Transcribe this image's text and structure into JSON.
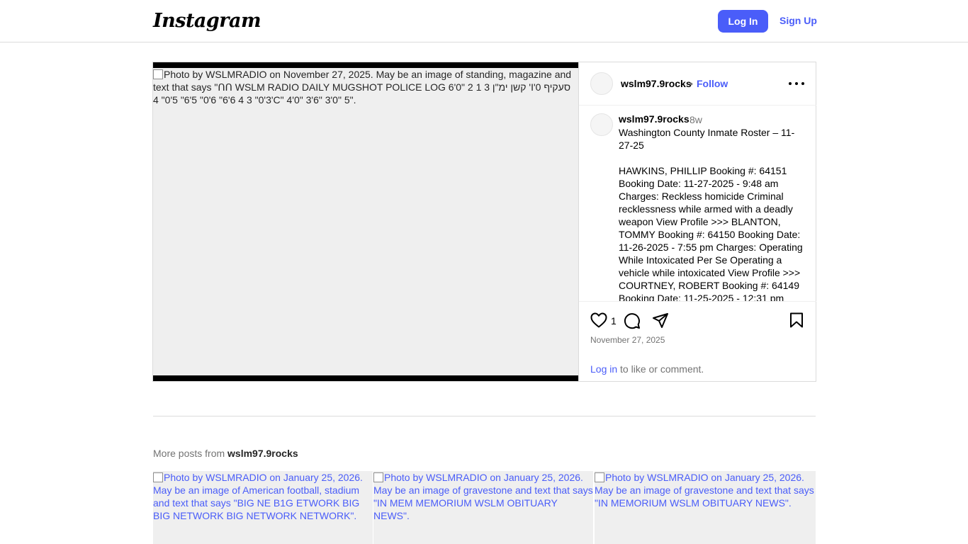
{
  "header": {
    "logo": "Instagram",
    "login_label": "Log In",
    "signup_label": "Sign Up"
  },
  "post": {
    "image_alt": "Photo by WSLMRADIO on November 27, 2025. May be an image of standing, magazine and text that says \"ᑎᑎ WSLM RADIO DAILY MUGSHOT POLICE LOG 6'0\" 2 1 קשן ימ\"ן 3 'I'0 סעקיף 3'0\" 3 4 6'6\" 6'0\" 5'6\" 5'0\" 4'C\" 4'0\" 3'6\" 3'0\" 5\".",
    "username": "wslm97.9rocks",
    "follow_label": "Follow",
    "caption_username": "wslm97.9rocks",
    "caption_time": "8w",
    "caption_text": "Washington County Inmate Roster – 11-27-25\n\nHAWKINS, PHILLIP Booking #: 64151 Booking Date: 11-27-2025 - 9:48 am Charges: Reckless homicide Criminal recklessness while armed with a deadly weapon View Profile >>> BLANTON, TOMMY Booking #: 64150 Booking Date: 11-26-2025 - 7:55 pm Charges: Operating While Intoxicated Per Se Operating a vehicle while intoxicated View Profile >>> COURTNEY, ROBERT Booking #: 64149 Booking Date: 11-25-2025 - 12:31 pm",
    "like_count": "1",
    "date": "November 27, 2025",
    "login_link": "Log in",
    "login_suffix": " to like or comment."
  },
  "more_posts": {
    "prefix": "More posts from ",
    "username": "wslm97.9rocks",
    "items": [
      {
        "alt": "Photo by WSLMRADIO on January 25, 2026. May be an image of American football, stadium and text that says \"BIG NE B1G ETWORK BIG BIG NETWORK BIG NETWORK NETWORK\"."
      },
      {
        "alt": "Photo by WSLMRADIO on January 25, 2026. May be an image of gravestone and text that says \"IN MEM MEMORIUM WSLM OBITUARY NEWS\"."
      },
      {
        "alt": "Photo by WSLMRADIO on January 25, 2026. May be an image of gravestone and text that says \"IN MEMORIUM WSLM OBITUARY NEWS\"."
      }
    ]
  }
}
